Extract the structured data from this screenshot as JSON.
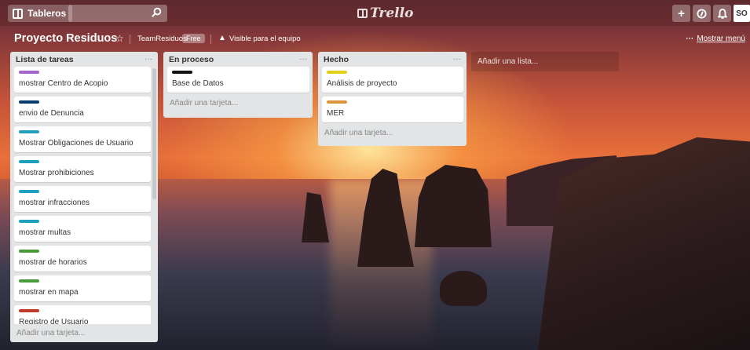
{
  "header": {
    "boards_label": "Tableros",
    "search_placeholder": "",
    "logo_text": "Trello",
    "add_icon": "plus-icon",
    "info_icon": "info-icon",
    "notif_icon": "bell-icon",
    "avatar_initials": "SO"
  },
  "board": {
    "title": "Proyecto Residuos",
    "team": "TeamResiduos",
    "badge": "Free",
    "visibility": "Visible para el equipo",
    "menu_label": "Mostrar menú",
    "add_list_label": "Añadir una lista..."
  },
  "lists": [
    {
      "title": "Lista de tareas",
      "add_card_label": "Añadir una tarjeta...",
      "cards": [
        {
          "label_color": "#a164c8",
          "title": "mostrar Centro de Acopio"
        },
        {
          "label_color": "#0a3c6e",
          "title": "envio de Denuncia"
        },
        {
          "label_color": "#1e9fbf",
          "title": "Mostrar Obligaciones de Usuario"
        },
        {
          "label_color": "#1e9fbf",
          "title": "Mostrar prohibiciones"
        },
        {
          "label_color": "#1e9fbf",
          "title": "mostrar infracciones"
        },
        {
          "label_color": "#1e9fbf",
          "title": "mostrar multas"
        },
        {
          "label_color": "#4a9a3a",
          "title": "mostrar de horarios"
        },
        {
          "label_color": "#4a9a3a",
          "title": "mostrar en mapa"
        },
        {
          "label_color": "#c0392b",
          "title": "Registro de Usuario"
        }
      ]
    },
    {
      "title": "En proceso",
      "add_card_label": "Añadir una tarjeta...",
      "cards": [
        {
          "label_color": "#111111",
          "title": "Base de Datos"
        }
      ]
    },
    {
      "title": "Hecho",
      "add_card_label": "Añadir una tarjeta...",
      "cards": [
        {
          "label_color": "#e0d01a",
          "title": "Análisis de proyecto"
        },
        {
          "label_color": "#d9963a",
          "title": "MER"
        }
      ]
    }
  ]
}
